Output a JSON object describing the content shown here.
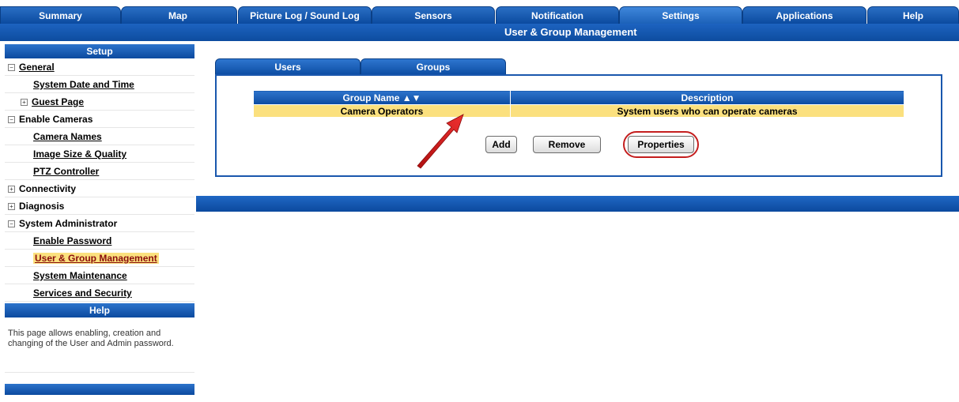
{
  "topnav": {
    "tabs": [
      {
        "label": "Summary"
      },
      {
        "label": "Map"
      },
      {
        "label": "Picture Log / Sound Log"
      },
      {
        "label": "Sensors"
      },
      {
        "label": "Notification"
      },
      {
        "label": "Settings",
        "active": true
      },
      {
        "label": "Applications"
      },
      {
        "label": "Help"
      }
    ]
  },
  "title": "User & Group Management",
  "sidebar": {
    "setup_heading": "Setup",
    "items": [
      {
        "label": "General",
        "expander": "−"
      },
      {
        "label": "System Date and Time"
      },
      {
        "label": "Guest Page",
        "expander": "+"
      },
      {
        "label": "Enable Cameras",
        "expander": "−"
      },
      {
        "label": "Camera Names"
      },
      {
        "label": "Image Size & Quality"
      },
      {
        "label": "PTZ Controller"
      },
      {
        "label": "Connectivity",
        "expander": "+"
      },
      {
        "label": "Diagnosis",
        "expander": "+"
      },
      {
        "label": "System Administrator",
        "expander": "−"
      },
      {
        "label": "Enable Password"
      },
      {
        "label": "User & Group Management",
        "current": true
      },
      {
        "label": "System Maintenance"
      },
      {
        "label": "Services and Security"
      }
    ],
    "help_heading": "Help",
    "help_text": "This page allows enabling, creation and changing of the User and Admin password."
  },
  "main": {
    "tabs": [
      {
        "label": "Users"
      },
      {
        "label": "Groups",
        "active": true
      }
    ],
    "table": {
      "columns": [
        "Group Name ▲▼",
        "Description"
      ],
      "rows": [
        [
          "Camera Operators",
          "System users who can operate cameras"
        ]
      ]
    },
    "buttons": {
      "add": "Add",
      "remove": "Remove",
      "properties": "Properties"
    }
  },
  "colors": {
    "brand_blue": "#0b4a9f",
    "selected_row": "#fbe07e",
    "annotation_red": "#d11a1a"
  }
}
